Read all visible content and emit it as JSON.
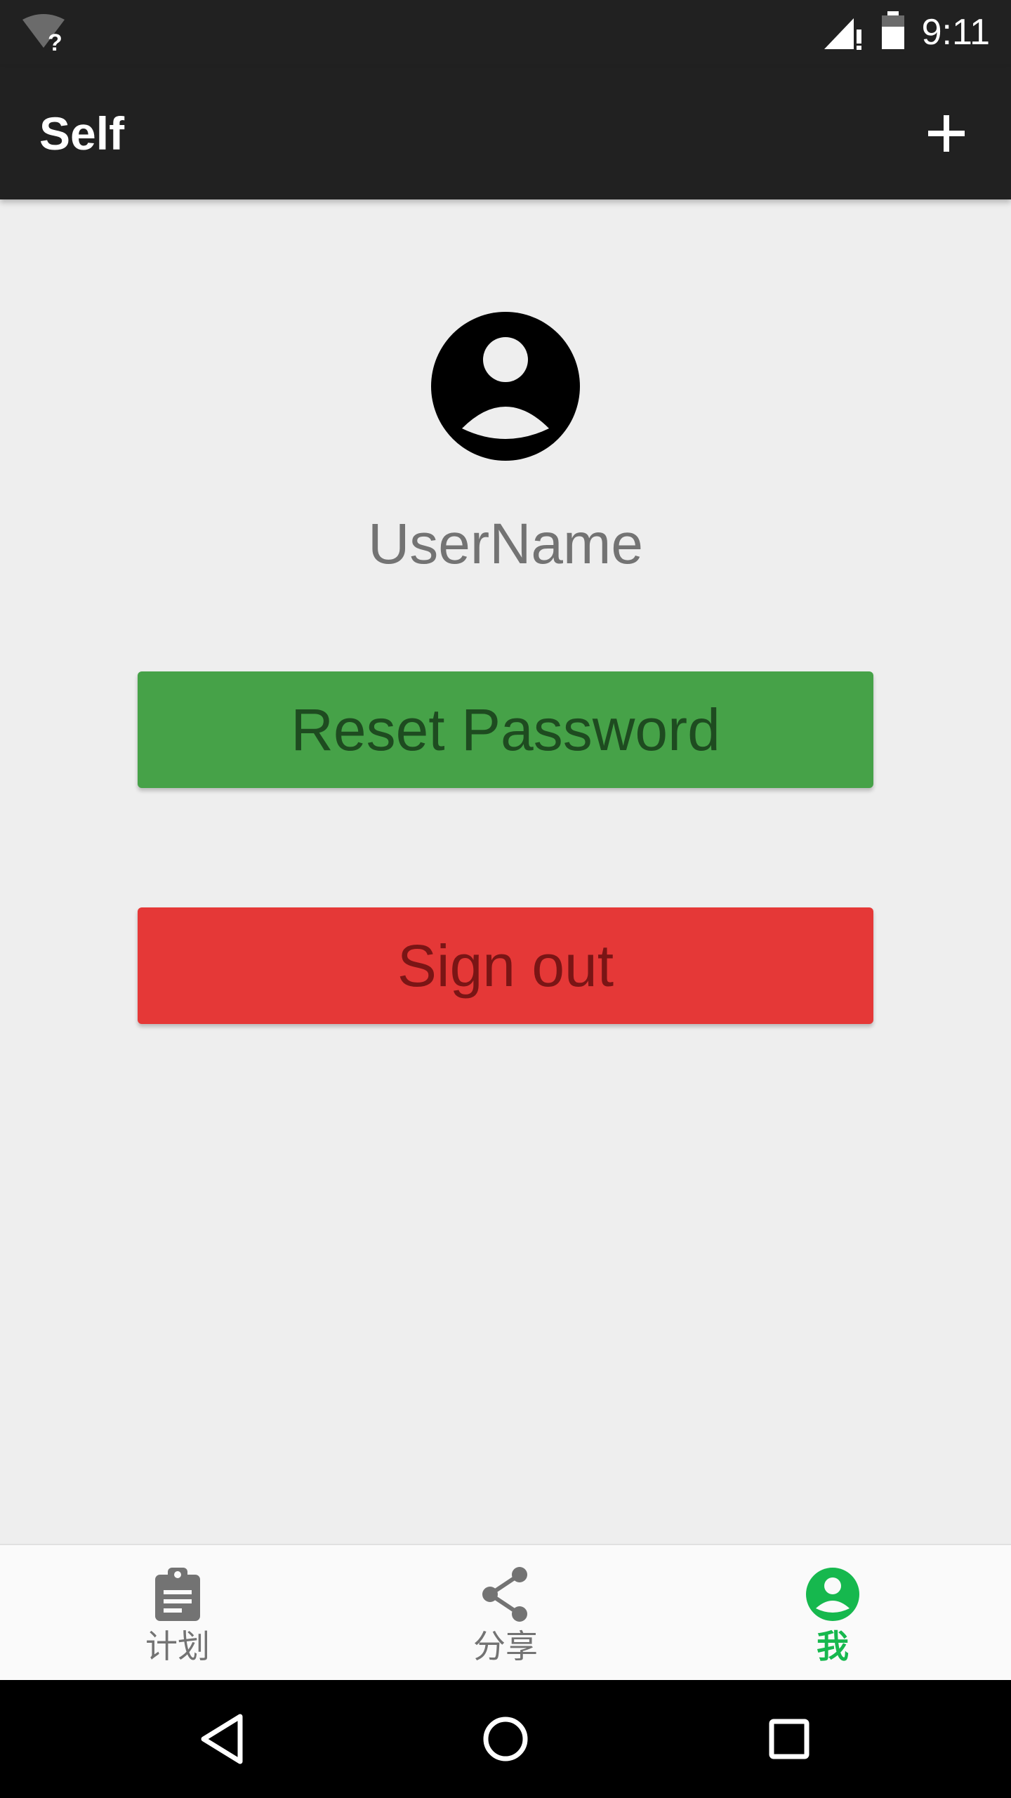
{
  "status_bar": {
    "time": "9:11",
    "wifi_icon": "wifi-unknown-icon",
    "signal_icon": "signal-no-data-icon",
    "battery_icon": "battery-icon"
  },
  "toolbar": {
    "title": "Self",
    "add_icon": "plus-icon"
  },
  "profile": {
    "avatar_icon": "account-circle-icon",
    "username": "UserName"
  },
  "buttons": {
    "reset_password": "Reset Password",
    "sign_out": "Sign out"
  },
  "bottom_nav": {
    "items": [
      {
        "label": "计划",
        "icon": "clipboard-icon",
        "active": false
      },
      {
        "label": "分享",
        "icon": "share-icon",
        "active": false
      },
      {
        "label": "我",
        "icon": "account-circle-icon",
        "active": true
      }
    ]
  },
  "system_nav": {
    "back_icon": "back-triangle-icon",
    "home_icon": "home-circle-icon",
    "recents_icon": "recents-square-icon"
  },
  "colors": {
    "app_bar": "#212121",
    "background": "#eeeeee",
    "reset_button": "#46a248",
    "sign_out_button": "#e53837",
    "active_tab": "#16b84e",
    "inactive_tab": "#737373"
  }
}
